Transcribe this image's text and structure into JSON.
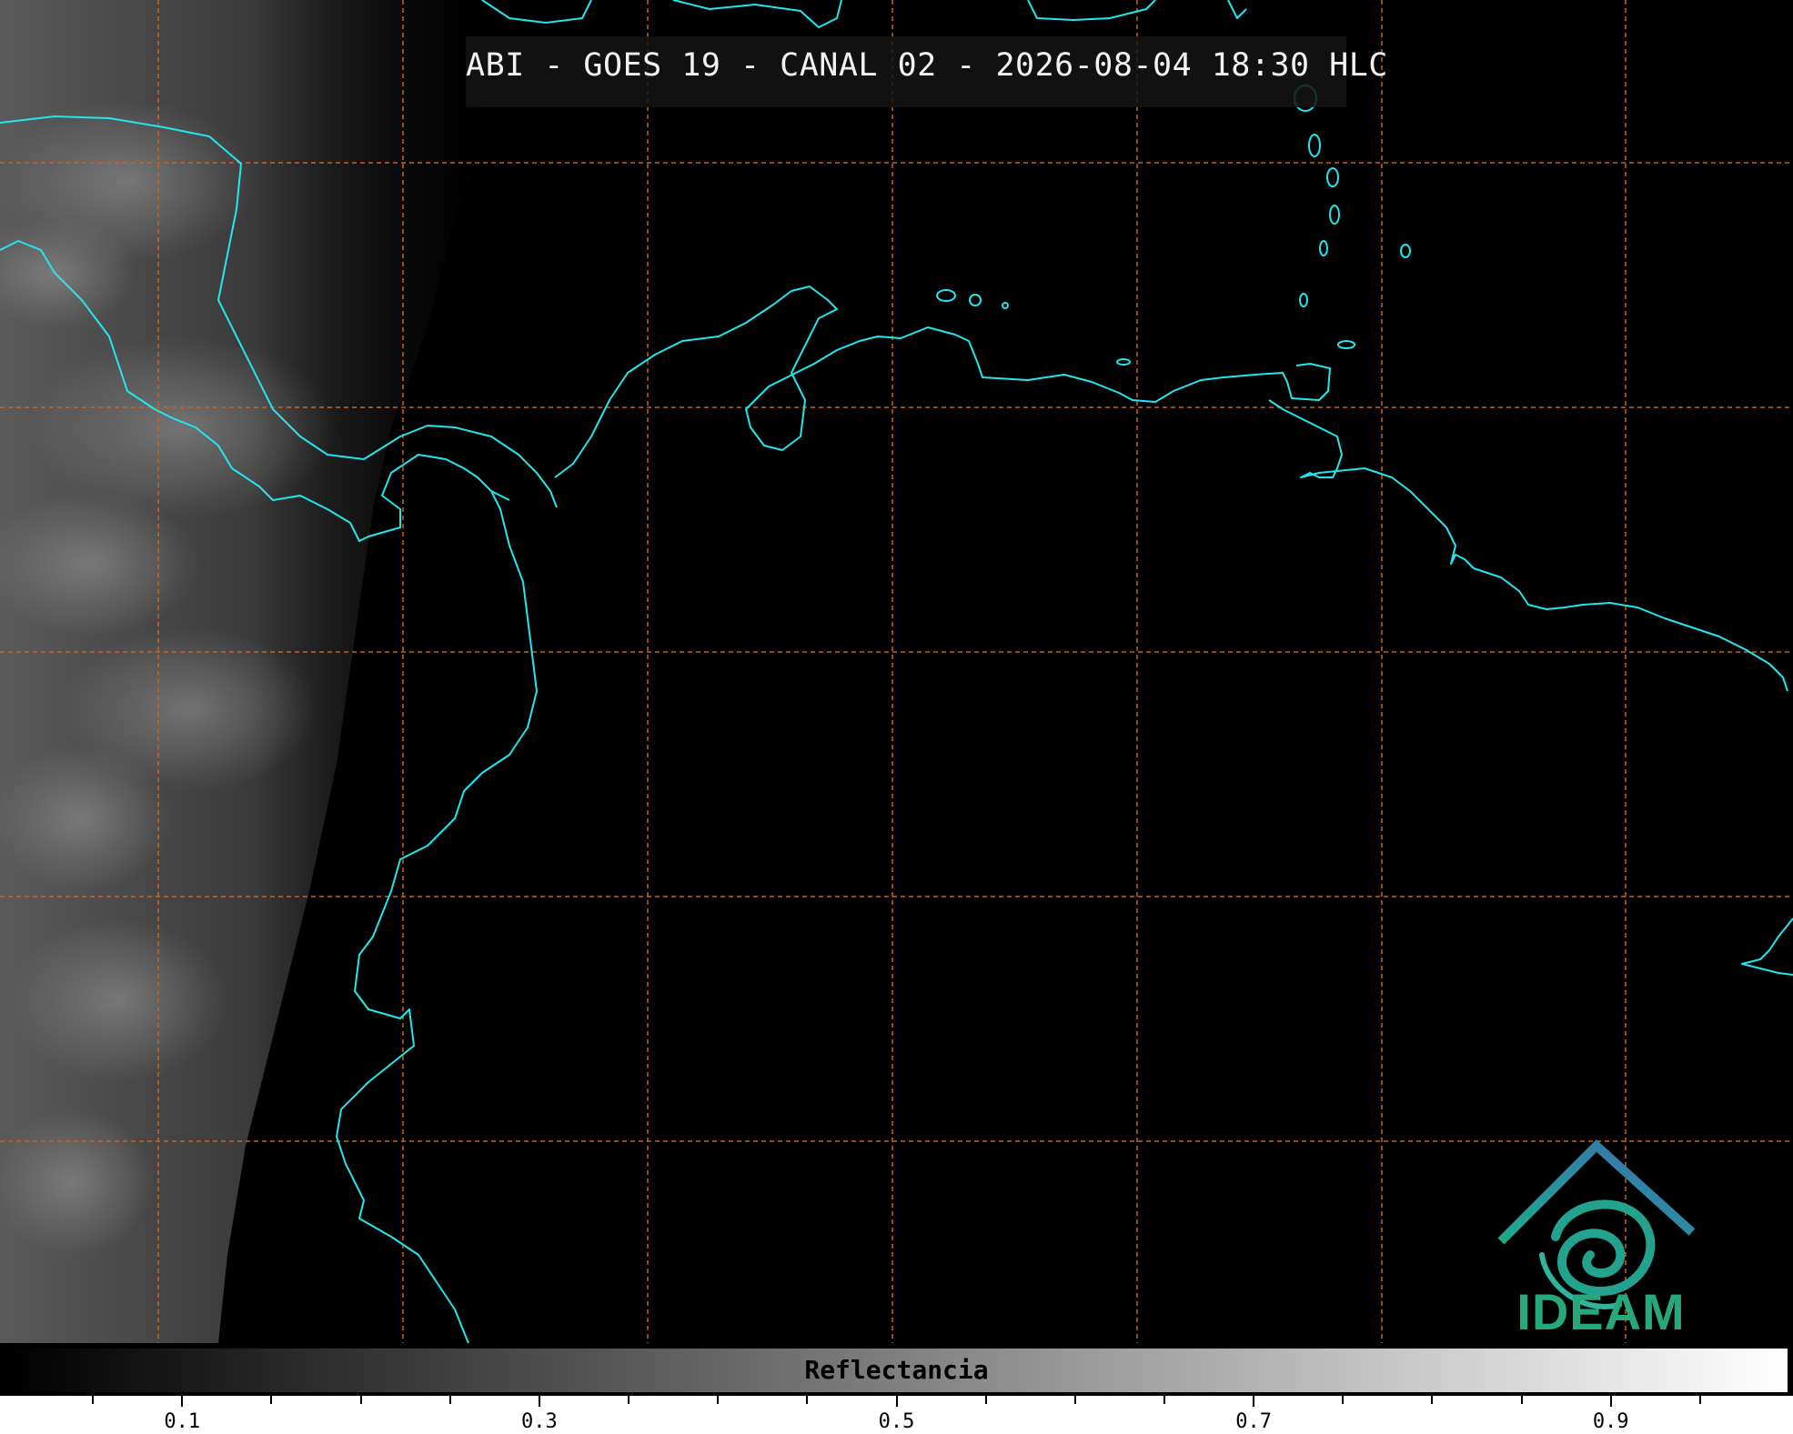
{
  "title": "ABI - GOES 19 - CANAL 02 - 2026-08-04 18:30 HLC",
  "colorbar": {
    "label": "Reflectancia",
    "range": [
      0.0,
      1.0
    ],
    "colormap": "grayscale",
    "ticks": [
      {
        "value": 0.1,
        "label": "0.1"
      },
      {
        "value": 0.3,
        "label": "0.3"
      },
      {
        "value": 0.5,
        "label": "0.5"
      },
      {
        "value": 0.7,
        "label": "0.7"
      },
      {
        "value": 0.9,
        "label": "0.9"
      }
    ]
  },
  "map": {
    "coastline_color": "#22e6ee",
    "graticule_color": "#c8641e",
    "graticule_style": "dashed",
    "background": "#000000"
  },
  "logo": {
    "text": "IDEAM",
    "text_color": "#27a87a",
    "roof_colors": [
      "#1fa98a",
      "#3a6fb4"
    ]
  }
}
